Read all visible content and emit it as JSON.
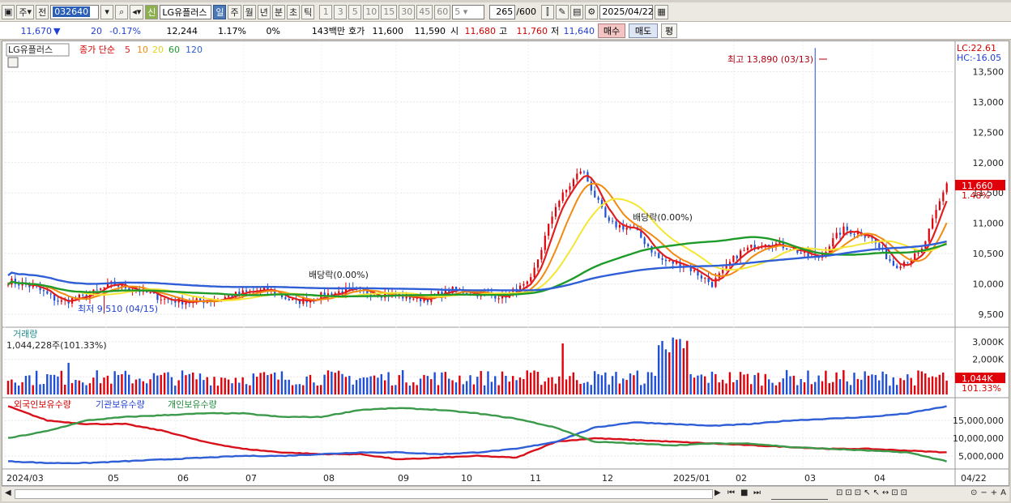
{
  "toolbar": {
    "b1": "주",
    "b2": "전",
    "code": "032640",
    "name": "LG유플러스",
    "badge": "신",
    "periods": [
      "일",
      "주",
      "월",
      "년",
      "분",
      "초",
      "틱"
    ],
    "nums": [
      "1",
      "3",
      "5",
      "10",
      "15",
      "30",
      "45",
      "60"
    ],
    "sel": "5",
    "count": "265",
    "total": "/600",
    "date": "2025/04/22"
  },
  "quote": {
    "price": "11,670",
    "arrow": "▼",
    "chg": "20",
    "pct": "-0.17%",
    "vol": "12,244",
    "vr": "1.17%",
    "z": "0%",
    "amt": "143백만",
    "hoga_l": "호가",
    "ask": "11,600",
    "bid": "11,590",
    "o_l": "시",
    "open": "11,680",
    "h_l": "고",
    "high": "11,760",
    "l_l": "저",
    "low": "11,640",
    "buy": "매수",
    "sell": "매도",
    "avg": "평"
  },
  "price_panel": {
    "name": "LG유플러스",
    "legend_prefix": "종가 단순",
    "ma": [
      "5",
      "10",
      "20",
      "60",
      "120"
    ],
    "lc": "LC:22.61",
    "hc": "HC:-16.05",
    "last": "11,660",
    "last_pct": "1.48%",
    "high_note": "최고 13,890 (03/13)",
    "low_note": "최저 9,510 (04/15)",
    "div1": "배당락(0.00%)",
    "div2": "배당락(0.00%)"
  },
  "vol_panel": {
    "title": "거래량",
    "value": "1,044,228주(101.33%)",
    "last": "1,044K",
    "last_pct": "101.33%"
  },
  "own_panel": {
    "t1": "외국인보유수량",
    "t2": "기관보유수량",
    "t3": "개인보유수량"
  },
  "colors": {
    "up": "#e0000a",
    "down": "#1f4fd6",
    "ma5": "#e21f1f",
    "ma10": "#f28a10",
    "ma20": "#f5e634",
    "ma60": "#1f9b2a",
    "ma120": "#2f5fd6"
  },
  "chart_data": [
    {
      "type": "candlestick",
      "title": "LG유플러스",
      "ylim": [
        9300,
        14000
      ],
      "y_ticks": [
        "9,500",
        "10,000",
        "10,500",
        "11,000",
        "11,500",
        "12,000",
        "12,500",
        "13,000",
        "13,500"
      ],
      "x_labels": [
        "2024/03",
        "05",
        "06",
        "07",
        "08",
        "09",
        "10",
        "11",
        "12",
        "2025/01",
        "02",
        "03",
        "04",
        "04/22"
      ],
      "close_approx": [
        10050,
        9950,
        9700,
        9800,
        10000,
        9900,
        9750,
        9700,
        9750,
        9850,
        9900,
        9700,
        9800,
        9900,
        9850,
        9800,
        9750,
        9900,
        9850,
        9800,
        10000,
        11300,
        11900,
        11000,
        10900,
        10400,
        10300,
        10000,
        10500,
        10700,
        10600,
        10400,
        10900,
        10800,
        10300,
        10500,
        11660
      ],
      "high": 13890,
      "low": 9510,
      "last": 11660
    },
    {
      "type": "bar",
      "title": "거래량",
      "y_ticks": [
        "1,000K",
        "2,000K",
        "3,000K"
      ],
      "last": "1,044K"
    },
    {
      "type": "line",
      "series": [
        {
          "name": "외국인보유수량"
        },
        {
          "name": "기관보유수량"
        },
        {
          "name": "개인보유수량"
        }
      ],
      "y_ticks": [
        "5,000,000",
        "10,000,000",
        "15,000,000"
      ]
    }
  ]
}
